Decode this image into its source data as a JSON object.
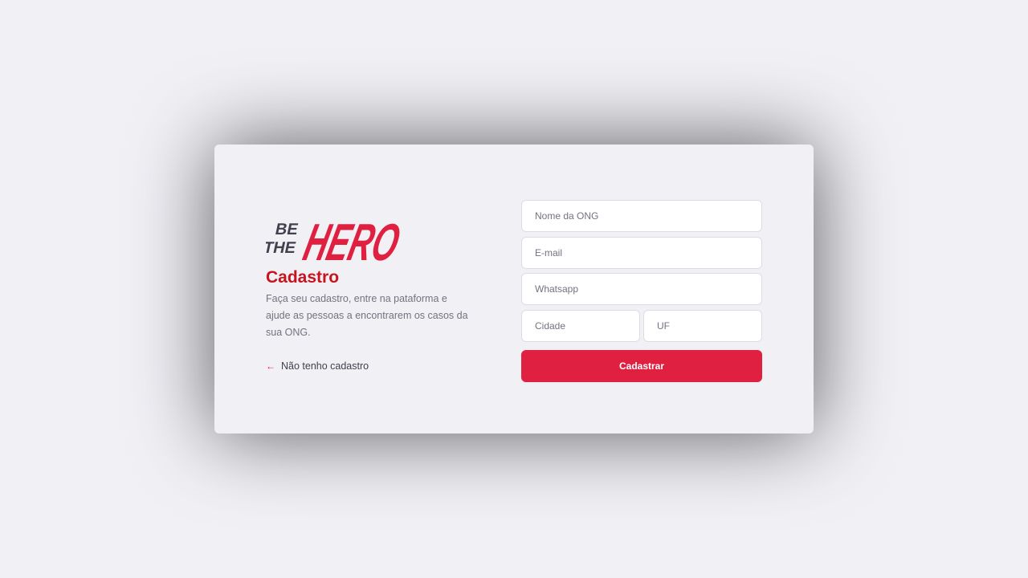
{
  "brand": {
    "logo_line1": "BE",
    "logo_line2": "THE",
    "logo_word": "HERO",
    "accent_color": "#e02041",
    "dark_color": "#41414d"
  },
  "intro": {
    "title": "Cadastro",
    "description": "Faça seu cadastro, entre na pataforma e ajude as pessoas a encontrarem os casos da sua ONG.",
    "back_link": "Não tenho cadastro",
    "back_icon": "arrow-left-icon"
  },
  "form": {
    "name_placeholder": "Nome da ONG",
    "email_placeholder": "E-mail",
    "whatsapp_placeholder": "Whatsapp",
    "city_placeholder": "Cidade",
    "uf_placeholder": "UF",
    "submit_label": "Cadastrar"
  }
}
